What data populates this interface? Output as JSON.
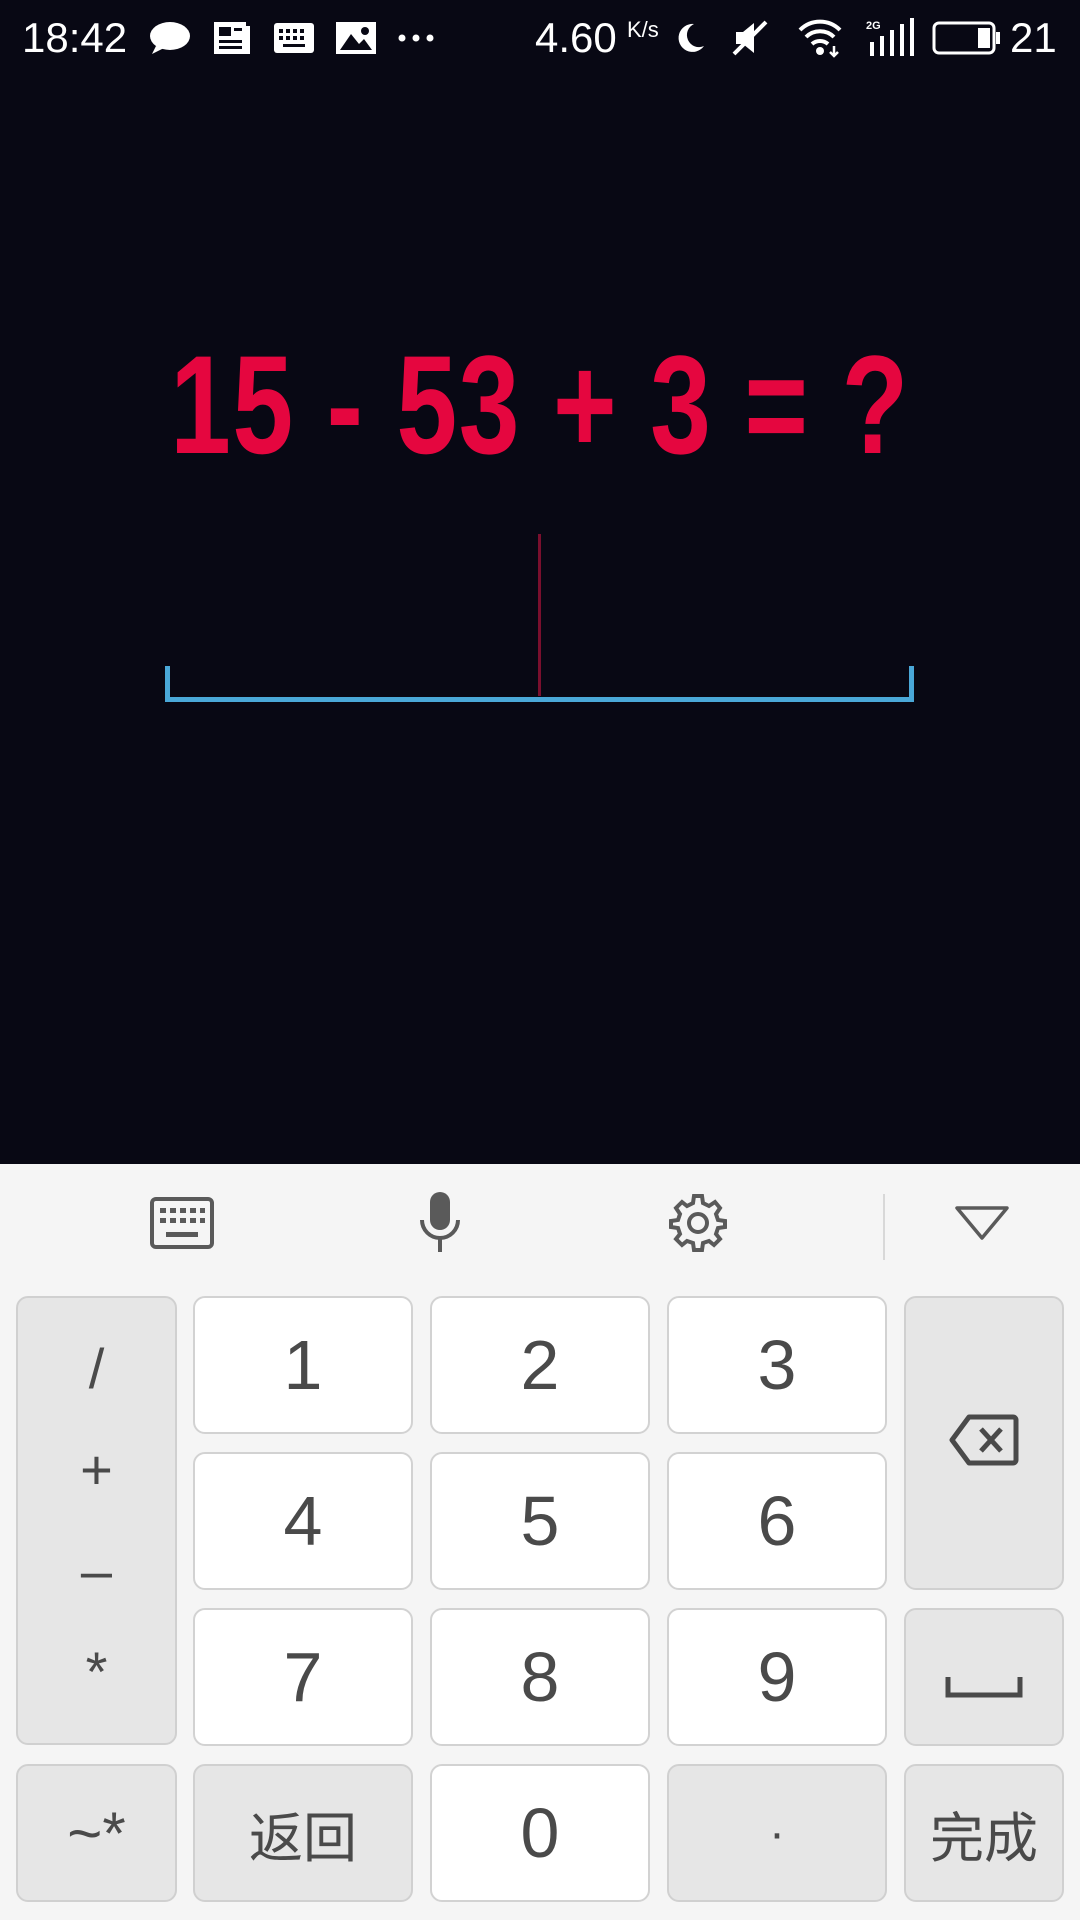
{
  "status_bar": {
    "time": "18:42",
    "speed": "4.60",
    "speed_unit": "K/s",
    "signal_label": "2G",
    "battery": "21"
  },
  "game": {
    "equation": "15 - 53 + 3 = ?",
    "answer": ""
  },
  "keyboard": {
    "toolbar": {
      "keyboard_icon": "keyboard-icon",
      "mic_icon": "microphone-icon",
      "settings_icon": "gear-icon",
      "hide_icon": "triangle-down-icon"
    },
    "symbols": [
      "/",
      "+",
      "–",
      "*"
    ],
    "digits": [
      "1",
      "2",
      "3",
      "4",
      "5",
      "6",
      "7",
      "8",
      "9",
      "0"
    ],
    "tilde_key": "~*",
    "back_key": "返回",
    "dot_key": "·",
    "done_key": "完成",
    "space_key": "space",
    "backspace_key": "backspace"
  },
  "colors": {
    "background": "#080814",
    "equation": "#e5063f",
    "answer_line": "#4aa8d8"
  }
}
